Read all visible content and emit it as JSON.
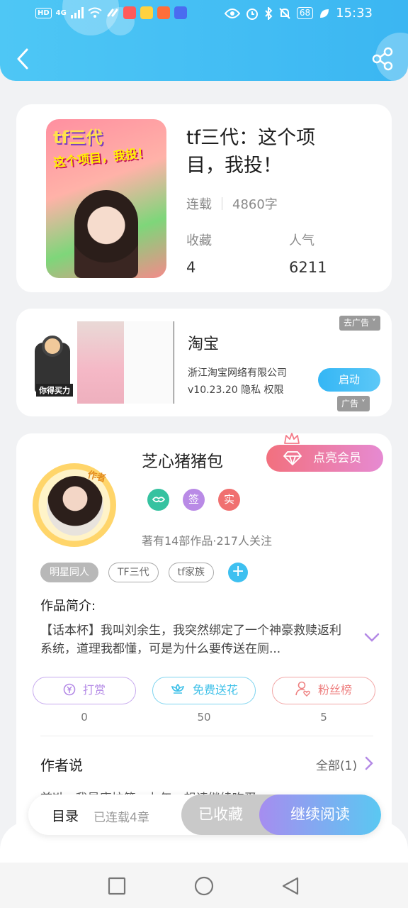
{
  "status_bar": {
    "time": "15:33",
    "battery": "68",
    "hd": "HD",
    "network": "4G"
  },
  "book": {
    "title": "tf三代：这个项目，我投！",
    "status": "连载",
    "word_count": "4860字",
    "favorites_label": "收藏",
    "favorites_value": "4",
    "popularity_label": "人气",
    "popularity_value": "6211",
    "cover_title": "tf三代",
    "cover_subtitle": "这个项目，我投！"
  },
  "ad": {
    "app_name": "淘宝",
    "company": "浙江淘宝网络有限公司",
    "version_line": "v10.23.20  隐私  权限",
    "launch_label": "启动",
    "remove_ad_label": "去广告 ˅",
    "ad_mark_label": "广告 ˅",
    "image_tag": "你得买力"
  },
  "author": {
    "name": "芝心猪猪包",
    "avatar_tag": "作者",
    "vip_button": "点亮会员",
    "badges": [
      {
        "icon": "handshake-icon",
        "label": "",
        "color": "#36c2a0"
      },
      {
        "icon": "sign-icon",
        "label": "签",
        "color": "#b98ae6"
      },
      {
        "icon": "verified-icon",
        "label": "实",
        "color": "#f07070"
      }
    ],
    "stats": "著有14部作品·217人关注"
  },
  "tags": [
    "明星同人",
    "TF三代",
    "tf家族"
  ],
  "intro": {
    "title": "作品简介:",
    "text": "【话本杯】我叫刘余生，我突然绑定了一个神豪救赎返利系统，道理我都懂，可是为什么要传送在厕..."
  },
  "actions": [
    {
      "label": "打赏",
      "count": "0",
      "color": "#b48ae6"
    },
    {
      "label": "免费送花",
      "count": "50",
      "color": "#3ec0e8"
    },
    {
      "label": "粉丝榜",
      "count": "5",
      "color": "#ee8080"
    }
  ],
  "author_says": {
    "title": "作者说",
    "all_label": "全部(1)",
    "peek": "首발，我是康拉第一九年，想请继续吃蛋..."
  },
  "bottom_bar": {
    "toc": "目录",
    "chapters": "已连载4章",
    "collected": "已收藏",
    "continue": "继续阅读"
  },
  "colors": {
    "header": "#3bb6f2",
    "accent_blue": "#34b6f5",
    "vip_pink": "#f2707e"
  }
}
